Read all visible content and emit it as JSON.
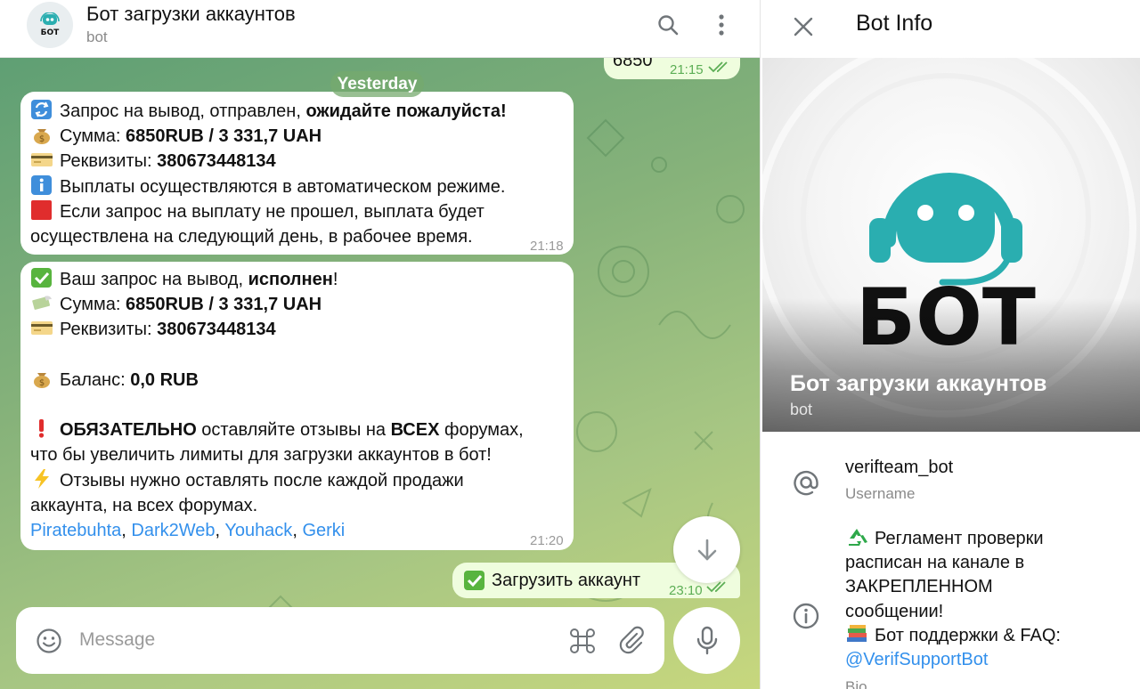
{
  "chat": {
    "title": "Бот загрузки аккаунтов",
    "subtitle": "bot",
    "avatar_text": "БОТ",
    "date_divider": "Yesterday",
    "top_partial": {
      "text": "6850",
      "time": "21:15"
    },
    "msg1": {
      "l1a": "Запрос на вывод,  отправлен, ",
      "l1b": "ожидайте пожалуйста!",
      "l2a": "Сумма: ",
      "l2b": "6850RUB  / 3 331,7 UAH",
      "l3a": "Реквизиты: ",
      "l3b": "380673448134",
      "l4": "Выплаты осуществляются в автоматическом режиме.",
      "l5": "Если запрос на выплату не прошел, выплата будет",
      "l6": "осуществлена на следующий день, в рабочее время.",
      "time": "21:18"
    },
    "msg2": {
      "l1a": "Ваш запрос на вывод, ",
      "l1b": "исполнен",
      "l1c": "!",
      "l2a": "Сумма: ",
      "l2b": "6850RUB  / 3 331,7 UAH",
      "l3a": "Реквизиты: ",
      "l3b": "380673448134",
      "l5a": "Баланс: ",
      "l5b": "0,0 RUB",
      "l7a": "ОБЯЗАТЕЛЬНО",
      "l7b": " оставляйте отзывы на ",
      "l7c": "ВСЕХ",
      "l7d": " форумах,",
      "l8": "что бы увеличить лимиты для загрузки аккаунтов в бот!",
      "l9": "Отзывы нужно оставлять после каждой продажи",
      "l10": "аккаунта, на всех форумах.",
      "links": [
        "Piratebuhta",
        "Dark2Web",
        "Youhack",
        "Gerki"
      ],
      "sep": ", ",
      "time": "21:20"
    },
    "msg3": {
      "text": "Загрузить аккаунт",
      "time": "23:10"
    },
    "composer_placeholder": "Message"
  },
  "info": {
    "header_title": "Bot Info",
    "photo_word": "БОТ",
    "name": "Бот загрузки аккаунтов",
    "subtitle": "bot",
    "username": "verifteam_bot",
    "username_label": "Username",
    "bio_lines": [
      "Регламент проверки",
      "расписан на канале в",
      "ЗАКРЕПЛЕННОМ",
      "сообщении!",
      "Бот поддержки & FAQ:"
    ],
    "bio_link": "@VerifSupportBot",
    "bio_label": "Bio"
  },
  "colors": {
    "accent": "#3390ec",
    "outgoing_bubble": "#effdde",
    "read_check": "#5cae55",
    "robot_teal": "#2aaeb0"
  },
  "icons": [
    "search-icon",
    "more-vertical-icon",
    "close-icon",
    "arrow-down-icon",
    "emoji-icon",
    "command-icon",
    "paperclip-icon",
    "mic-icon",
    "at-icon",
    "info-icon"
  ]
}
